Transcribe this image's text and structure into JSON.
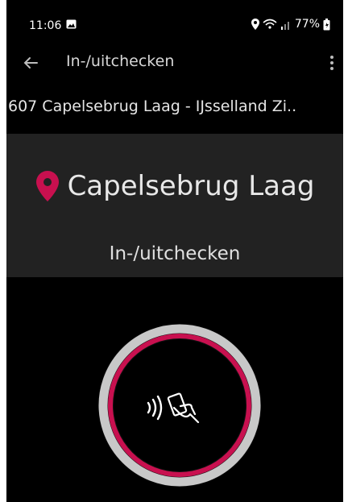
{
  "status": {
    "time": "11:06",
    "battery": "77%"
  },
  "header": {
    "title": "In-/uitchecken"
  },
  "route": {
    "label": "607 Capelsebrug Laag - IJsselland Zi.."
  },
  "stop": {
    "name": "Capelsebrug Laag",
    "action": "In-/uitchecken"
  },
  "icons": {
    "back": "arrow-left-icon",
    "menu": "more-vert-icon",
    "location": "map-pin-icon",
    "nfc": "contactless-card-icon"
  },
  "colors": {
    "accent": "#c8104f",
    "panel": "#222222",
    "ring": "#c8c8c8"
  }
}
